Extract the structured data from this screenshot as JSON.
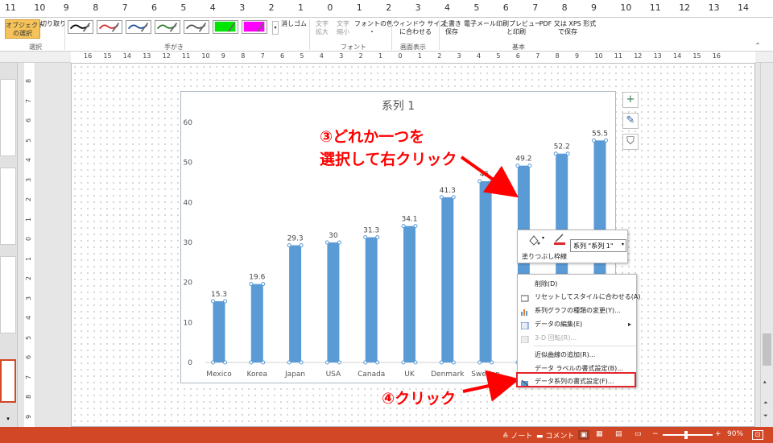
{
  "top_ruler": [
    "11",
    "10",
    "9",
    "8",
    "7",
    "6",
    "5",
    "4",
    "3",
    "2",
    "1",
    "0",
    "1",
    "2",
    "3",
    "4",
    "5",
    "6",
    "7",
    "8",
    "9",
    "10",
    "11",
    "12",
    "13",
    "14"
  ],
  "ribbon": {
    "select_object": "オブジェクト\nの選択",
    "cut": "切り取り",
    "eraser": "消しゴム",
    "text_expand": "文字\n拡大",
    "text_shrink": "文字\n縮小",
    "font_color": "フォントの色\n・",
    "fit_window": "ウィンドウ サイズ\nに合わせる",
    "overwrite_save": "上書き\n保存",
    "email": "電子メール",
    "print_preview": "印刷プレビュー\nと印刷",
    "save_pdf": "PDF 又は XPS 形式\nで保存",
    "groups": {
      "select": "選択",
      "handwriting": "手がき",
      "font": "フォント",
      "display": "画面表示",
      "basic": "基本"
    },
    "pen_colors": [
      "#000000",
      "#d32f2f",
      "#1f4e9c",
      "#2e7d32",
      "#555555",
      "#00e600",
      "#ff00ff"
    ]
  },
  "hruler": [
    "16",
    "15",
    "14",
    "13",
    "12",
    "11",
    "10",
    "9",
    "8",
    "7",
    "6",
    "5",
    "4",
    "3",
    "2",
    "1",
    "0",
    "1",
    "2",
    "3",
    "4",
    "5",
    "6",
    "7",
    "8",
    "9",
    "10",
    "11",
    "12",
    "13",
    "14",
    "15",
    "16"
  ],
  "vruler": [
    "8",
    "7",
    "6",
    "5",
    "4",
    "3",
    "2",
    "1",
    "0",
    "1",
    "2",
    "3",
    "4",
    "5",
    "6",
    "7",
    "8",
    "9"
  ],
  "chart_data": {
    "type": "bar",
    "title": "系列 1",
    "categories": [
      "Mexico",
      "Korea",
      "Japan",
      "USA",
      "Canada",
      "UK",
      "Denmark",
      "Sweden",
      "",
      "",
      ""
    ],
    "series": [
      {
        "values": [
          15.3,
          19.6,
          29.3,
          30,
          31.3,
          34.1,
          41.3,
          45.3,
          49.2,
          52.2,
          55.5
        ]
      }
    ],
    "data_labels": [
      "15.3",
      "19.6",
      "29.3",
      "30",
      "31.3",
      "34.1",
      "41.3",
      "45.",
      "49.2",
      "52.2",
      "55.5"
    ],
    "y_ticks": [
      "0",
      "10",
      "20",
      "30",
      "40",
      "50",
      "60"
    ],
    "ylim": [
      0,
      60
    ],
    "grid": false,
    "bar_color": "#5b9bd5"
  },
  "chart_buttons": {
    "add": "+",
    "style": "✎",
    "filter": "⛉"
  },
  "annotations": {
    "step3_line1": "③どれか一つを",
    "step3_line2": "選択して右クリック",
    "step4": "④クリック"
  },
  "mini_toolbar": {
    "fill": "塗りつぶし",
    "outline": "枠線",
    "series_select": "系列 \"系列 1\""
  },
  "context_menu": [
    {
      "label": "削除(D)",
      "disabled": false
    },
    {
      "label": "リセットしてスタイルに合わせる(A)",
      "disabled": false
    },
    {
      "label": "系列グラフの種類の変更(Y)...",
      "disabled": false
    },
    {
      "label": "データの編集(E)",
      "disabled": false
    },
    {
      "label": "3-D 回転(R)...",
      "disabled": true
    },
    {
      "label": "近似曲線の追加(R)...",
      "disabled": false
    },
    {
      "label": "データ ラベルの書式設定(B)...",
      "disabled": false
    },
    {
      "label": "データ系列の書式設定(F)...",
      "disabled": false
    }
  ],
  "status_bar": {
    "notes": "ノート",
    "comments": "コメント",
    "zoom": "90%"
  }
}
